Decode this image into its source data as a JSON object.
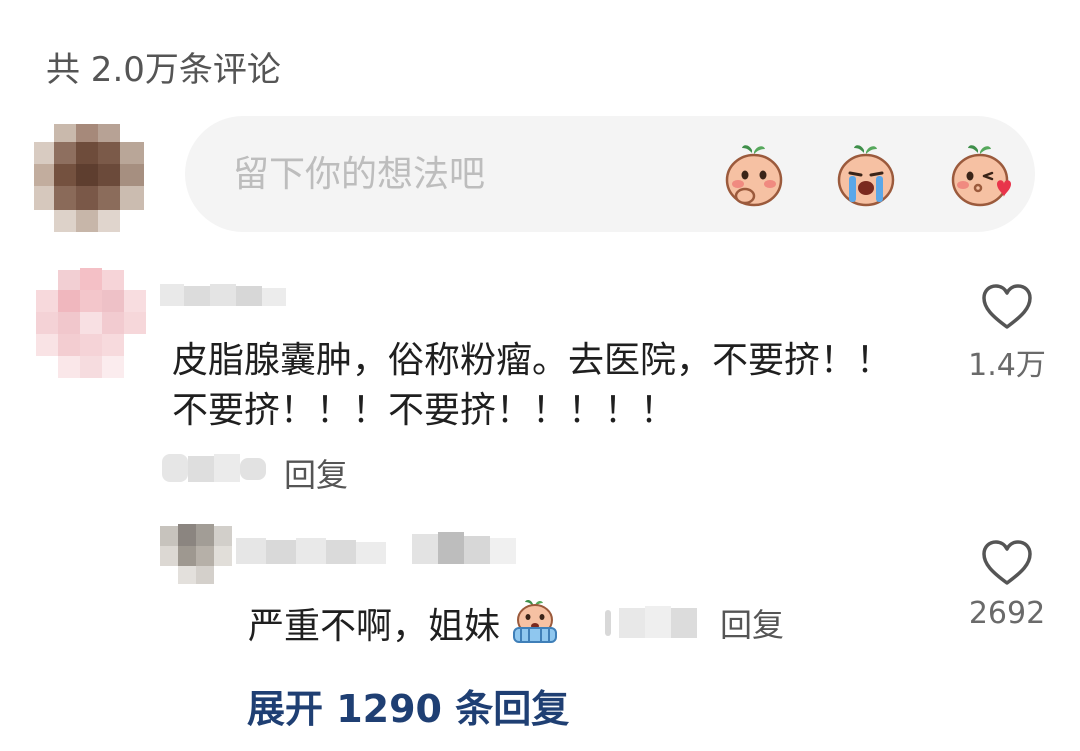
{
  "header": {
    "comment_count_label": "共 2.0万条评论"
  },
  "composer": {
    "placeholder": "留下你的想法吧",
    "stickers": [
      "sticker-shy-icon",
      "sticker-cry-icon",
      "sticker-kiss-icon"
    ]
  },
  "comments": [
    {
      "text": "皮脂腺囊肿，俗称粉瘤。去医院，不要挤！！不要挤！！！不要挤！！！！！",
      "reply_label": "回复",
      "likes": "1.4万",
      "replies": [
        {
          "text": "严重不啊，姐妹",
          "emoji": "sticker-worried-icon",
          "reply_label": "回复",
          "likes": "2692"
        }
      ],
      "expand_label": "展开 1290 条回复"
    }
  ],
  "colors": {
    "link": "#1f3f73",
    "secondary_text": "#555555",
    "placeholder": "#bdbdbd",
    "input_bg": "#f4f4f4"
  }
}
